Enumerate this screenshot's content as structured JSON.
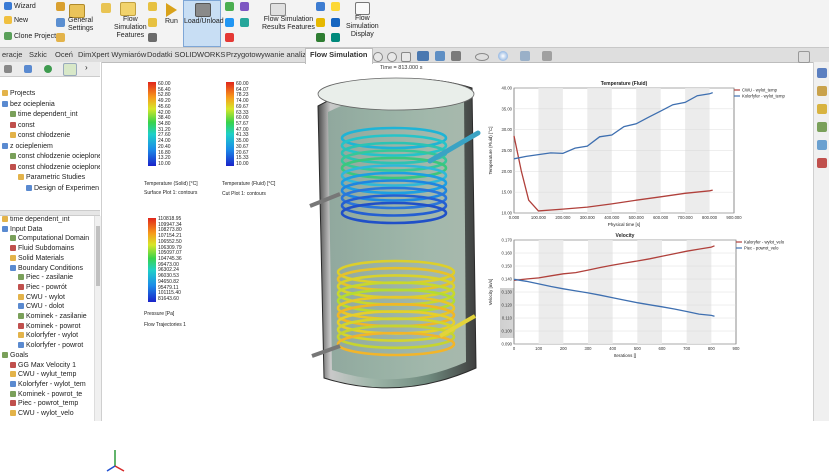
{
  "ribbon": {
    "items": [
      {
        "label": "Wizard"
      },
      {
        "label": "New"
      },
      {
        "label": "Clone Project"
      },
      {
        "label": "General\nSettings"
      },
      {
        "label": "Flow\nSimulation\nFeatures"
      },
      {
        "label": "Run"
      },
      {
        "label": "Load/Unload"
      },
      {
        "label": "Flow Simulation\nResults Features"
      },
      {
        "label": "Flow\nSimulation\nDisplay"
      }
    ]
  },
  "tabs": [
    "eracje",
    "Szkic",
    "Oceń",
    "DimXpert Wymiarów",
    "Dodatki SOLIDWORKS",
    "Przygotowywanie analizy",
    "Flow Simulation"
  ],
  "active_tab_index": 6,
  "tree_top": [
    {
      "label": "Projects",
      "level": 0
    },
    {
      "label": "bez ocieplenia",
      "level": 0
    },
    {
      "label": "time dependent_int",
      "level": 1
    },
    {
      "label": "const",
      "level": 1
    },
    {
      "label": "const chłodzenie",
      "level": 1
    },
    {
      "label": "z ociepleniem",
      "level": 0
    },
    {
      "label": "const chłodzenie ocieplone",
      "level": 1
    },
    {
      "label": "const chłodzenie ocieplone",
      "level": 1
    },
    {
      "label": "Parametric Studies",
      "level": 2
    },
    {
      "label": "Design of Experimen",
      "level": 3
    }
  ],
  "tree_bottom": [
    {
      "label": "time dependent_int",
      "level": 0
    },
    {
      "label": "Input Data",
      "level": 0
    },
    {
      "label": "Computational Domain",
      "level": 1
    },
    {
      "label": "Fluid Subdomains",
      "level": 1
    },
    {
      "label": "Solid Materials",
      "level": 1
    },
    {
      "label": "Boundary Conditions",
      "level": 1
    },
    {
      "label": "Piec - zasilanie",
      "level": 2
    },
    {
      "label": "Piec - powrót",
      "level": 2
    },
    {
      "label": "CWU - wylot",
      "level": 2
    },
    {
      "label": "CWU - dolot",
      "level": 2
    },
    {
      "label": "Kominek - zasilanie",
      "level": 2
    },
    {
      "label": "Kominek - powrot",
      "level": 2
    },
    {
      "label": "Kolorfyfer - wylot",
      "level": 2
    },
    {
      "label": "Kolorfyfer - powrot",
      "level": 2
    },
    {
      "label": "Goals",
      "level": 0
    },
    {
      "label": "GG Max Velocity 1",
      "level": 1
    },
    {
      "label": "CWU - wylut_temp",
      "level": 1
    },
    {
      "label": "Kolorfyfer - wylot_tem",
      "level": 1
    },
    {
      "label": "Kominek - powrot_te",
      "level": 1
    },
    {
      "label": "Piec - powrot_temp",
      "level": 1
    },
    {
      "label": "CWU - wylot_velo",
      "level": 1
    }
  ],
  "time_label": "Time = 813.000 s",
  "legends": [
    {
      "values": [
        "60.00",
        "56.40",
        "52.80",
        "49.20",
        "45.60",
        "42.00",
        "38.40",
        "34.80",
        "31.20",
        "27.60",
        "24.00",
        "20.40",
        "16.80",
        "13.20",
        "10.00"
      ],
      "title": "Temperature (Solid) [°C]",
      "caption": "Surface Plot 1: contours"
    },
    {
      "values": [
        "60.00",
        "64.07",
        "78.23",
        "74.00",
        "69.67",
        "63.33",
        "60.00",
        "57.67",
        "47.00",
        "41.33",
        "35.00",
        "30.67",
        "20.67",
        "15.33",
        "10.00"
      ],
      "title": "Temperature (Fluid) [°C]",
      "caption": "Cut Plot 1: contours"
    },
    {
      "values": [
        "110818.95",
        "109947.34",
        "108273.80",
        "107154.21",
        "106552.50",
        "106309.79",
        "105097.07",
        "104745.36",
        "99473.00",
        "96302.24",
        "96030.53",
        "94650.82",
        "95479.11",
        "101115.40",
        "81643.60"
      ],
      "title": "Pressure [Pa]",
      "caption": "Flow Trajectories 1"
    }
  ],
  "chart_data": [
    {
      "type": "line",
      "title": "Temperature (Fluid)",
      "xlabel": "Physical time [s]",
      "ylabel": "Temperature (Fluid) [°C]",
      "xlim": [
        0,
        900000
      ],
      "ylim": [
        10,
        40
      ],
      "xticks": [
        "0.000",
        "100.000",
        "200.000",
        "300.000",
        "400.000",
        "500.000",
        "600.000",
        "700.000",
        "800.000",
        "900.000"
      ],
      "yticks": [
        "10.00",
        "15.00",
        "20.00",
        "25.00",
        "30.00",
        "35.00",
        "40.00"
      ],
      "series": [
        {
          "name": "CWU - wylot_temp",
          "color": "#b0403b",
          "x": [
            0,
            30000,
            60000,
            100000,
            200000,
            300000,
            400000,
            500000,
            600000,
            700000,
            800000,
            813000
          ],
          "y": [
            28.5,
            20,
            13,
            10.5,
            11,
            11.5,
            12.2,
            13,
            13.8,
            14.7,
            15.4,
            15.5
          ]
        },
        {
          "name": "Kolorfyfer - wylot_temp",
          "color": "#3e6fb0",
          "x": [
            0,
            50000,
            100000,
            150000,
            200000,
            250000,
            300000,
            350000,
            400000,
            450000,
            500000,
            550000,
            600000,
            650000,
            700000,
            750000,
            800000,
            813000
          ],
          "y": [
            23,
            23.5,
            24,
            24.5,
            24.4,
            25.6,
            26,
            28.2,
            28.7,
            30.8,
            31.5,
            33,
            34.4,
            35.9,
            36.5,
            38.2,
            38.7,
            38.9
          ]
        }
      ]
    },
    {
      "type": "line",
      "title": "Velocity",
      "xlabel": "Iterations []",
      "ylabel": "Velocity [m/s]",
      "xlim": [
        0,
        900
      ],
      "ylim": [
        0.08,
        0.17
      ],
      "xticks": [
        "0",
        "100",
        "200",
        "300",
        "400",
        "500",
        "600",
        "700",
        "800",
        "900"
      ],
      "yticks": [
        "0.090",
        "0.100",
        "0.110",
        "0.120",
        "0.130",
        "0.140",
        "0.150",
        "0.160",
        "0.170"
      ],
      "series": [
        {
          "name": "Kaloryfer - wylot_velo",
          "color": "#b0403b",
          "x": [
            0,
            50,
            100,
            150,
            200,
            250,
            300,
            350,
            400,
            450,
            500,
            550,
            600,
            650,
            700,
            750,
            800,
            813
          ],
          "y": [
            0.135,
            0.136,
            0.137,
            0.139,
            0.141,
            0.142,
            0.144,
            0.146,
            0.148,
            0.15,
            0.152,
            0.154,
            0.156,
            0.158,
            0.16,
            0.162,
            0.164,
            0.165
          ]
        },
        {
          "name": "Piec - powrot_velo",
          "color": "#3e6fb0",
          "x": [
            0,
            50,
            100,
            150,
            200,
            250,
            300,
            350,
            400,
            450,
            500,
            550,
            600,
            650,
            700,
            750,
            800,
            813
          ],
          "y": [
            0.136,
            0.134,
            0.132,
            0.13,
            0.128,
            0.126,
            0.124,
            0.122,
            0.12,
            0.118,
            0.116,
            0.114,
            0.112,
            0.11,
            0.108,
            0.106,
            0.105,
            0.104
          ]
        }
      ]
    }
  ]
}
